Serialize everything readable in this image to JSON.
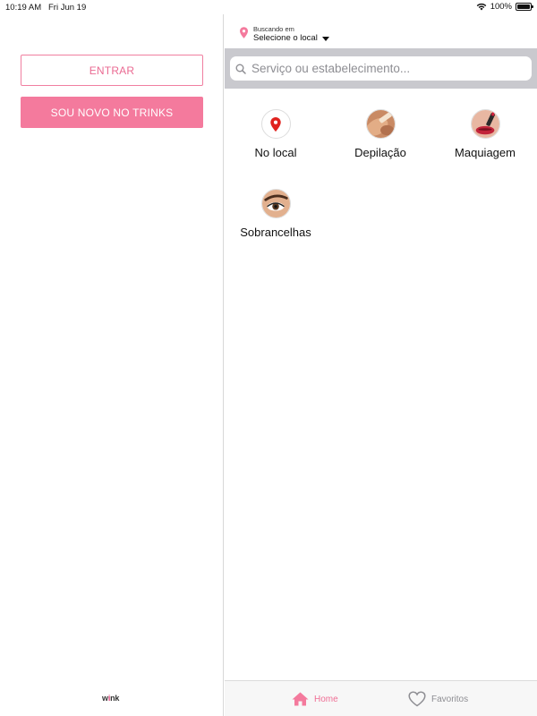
{
  "status_bar": {
    "time": "10:19 AM",
    "date": "Fri Jun 19",
    "battery": "100%",
    "battery_level": 1.0
  },
  "left_panel": {
    "login_label": "ENTRAR",
    "signup_label": "SOU NOVO NO TRINKS",
    "logo_text": "wink"
  },
  "location": {
    "caption": "Buscando em",
    "value": "Selecione o local"
  },
  "search": {
    "placeholder": "Serviço ou estabelecimento..."
  },
  "categories": [
    {
      "label": "No local",
      "icon": "location-pin-icon"
    },
    {
      "label": "Depilação",
      "icon": "depilation-photo"
    },
    {
      "label": "Maquiagem",
      "icon": "makeup-photo"
    },
    {
      "label": "Sobrancelhas",
      "icon": "eyebrow-photo"
    }
  ],
  "tab_bar": {
    "home_label": "Home",
    "favorites_label": "Favoritos"
  },
  "colors": {
    "brand_pink": "#f47a9d",
    "brand_pink_text": "#ea6a92",
    "pin_red": "#e0231f",
    "search_bg": "#c9c9ce",
    "tab_inactive": "#8e8e93"
  }
}
